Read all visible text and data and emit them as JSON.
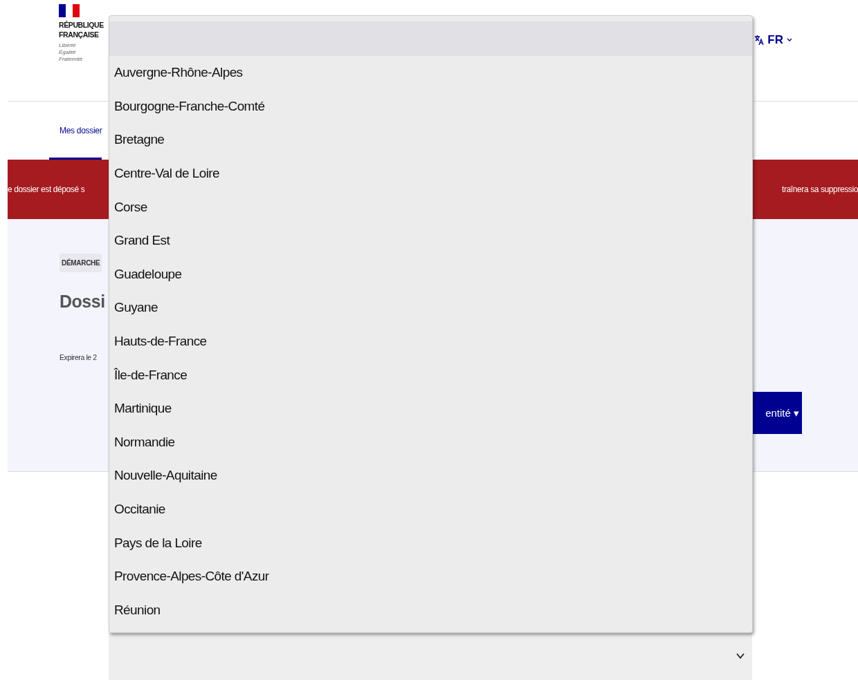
{
  "header": {
    "logo_lines": [
      "RÉPUBLIQUE",
      "FRANÇAISE"
    ],
    "motto": [
      "Liberté",
      "Égalité",
      "Fraternité"
    ],
    "language": "FR"
  },
  "nav": {
    "tabs": [
      {
        "label": "Mes dossier",
        "selected": true
      }
    ]
  },
  "banner": {
    "text_left": "e dossier est déposé s",
    "text_right": "traînera sa suppressio"
  },
  "content": {
    "tag": "DÉMARCHE",
    "title": "Dossi",
    "expiry": "Expirera le 2",
    "button": "entité ▾"
  },
  "dropdown": {
    "blank_option": {
      "selected": true
    },
    "options": [
      {
        "label": "Auvergne-Rhône-Alpes",
        "selected": false
      },
      {
        "label": "Bourgogne-Franche-Comté",
        "selected": false
      },
      {
        "label": "Bretagne",
        "selected": false
      },
      {
        "label": "Centre-Val de Loire",
        "selected": false
      },
      {
        "label": "Corse",
        "selected": false
      },
      {
        "label": "Grand Est",
        "selected": false
      },
      {
        "label": "Guadeloupe",
        "selected": false
      },
      {
        "label": "Guyane",
        "selected": false
      },
      {
        "label": "Hauts-de-France",
        "selected": false
      },
      {
        "label": "Île-de-France",
        "selected": false
      },
      {
        "label": "Martinique",
        "selected": false
      },
      {
        "label": "Normandie",
        "selected": false
      },
      {
        "label": "Nouvelle-Aquitaine",
        "selected": false
      },
      {
        "label": "Occitanie",
        "selected": false
      },
      {
        "label": "Pays de la Loire",
        "selected": false
      },
      {
        "label": "Provence-Alpes-Côte d'Azur",
        "selected": false
      },
      {
        "label": "Réunion",
        "selected": false
      }
    ]
  },
  "select_field": {
    "expanded": true
  }
}
